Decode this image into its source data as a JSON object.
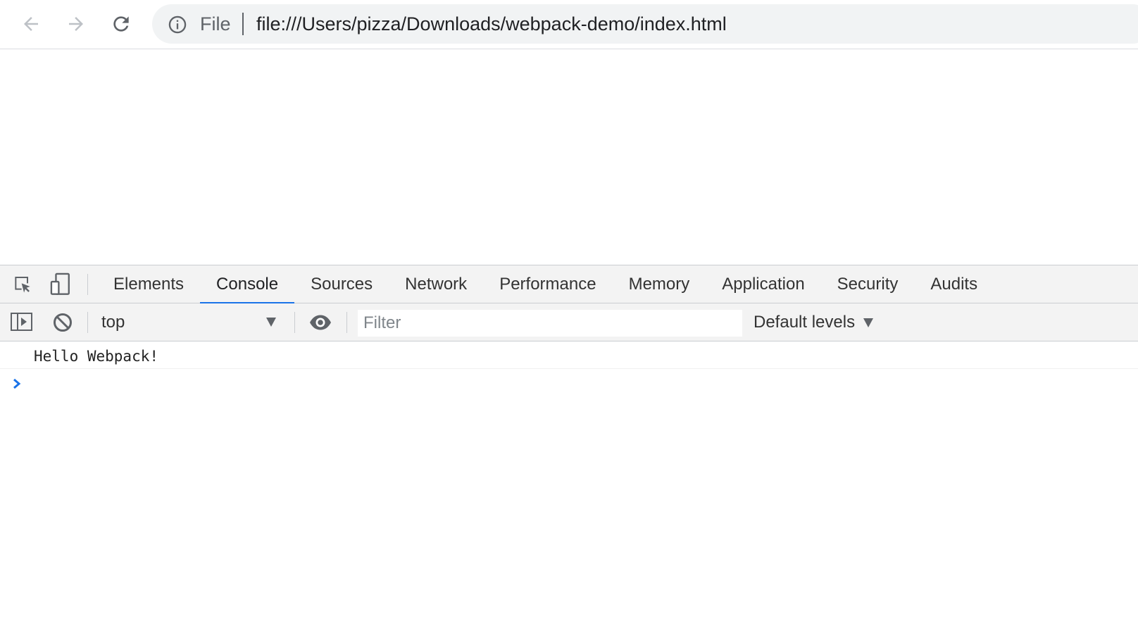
{
  "browser": {
    "back_icon": "arrow-left-icon",
    "forward_icon": "arrow-right-icon",
    "reload_icon": "reload-icon",
    "info_icon": "info-circle-icon",
    "scheme_label": "File",
    "url": "file:///Users/pizza/Downloads/webpack-demo/index.html"
  },
  "devtools": {
    "inspect_icon": "inspect-element-icon",
    "device_icon": "device-toolbar-icon",
    "tabs": [
      {
        "label": "Elements",
        "active": false
      },
      {
        "label": "Console",
        "active": true
      },
      {
        "label": "Sources",
        "active": false
      },
      {
        "label": "Network",
        "active": false
      },
      {
        "label": "Performance",
        "active": false
      },
      {
        "label": "Memory",
        "active": false
      },
      {
        "label": "Application",
        "active": false
      },
      {
        "label": "Security",
        "active": false
      },
      {
        "label": "Audits",
        "active": false
      }
    ],
    "console_toolbar": {
      "sidebar_icon": "console-sidebar-icon",
      "clear_icon": "clear-console-icon",
      "context_value": "top",
      "eye_icon": "eye-icon",
      "filter_placeholder": "Filter",
      "filter_value": "",
      "levels_label": "Default levels"
    },
    "console_messages": [
      "Hello Webpack!"
    ],
    "prompt_icon": "chevron-right-icon",
    "accent_color": "#1a73e8"
  }
}
